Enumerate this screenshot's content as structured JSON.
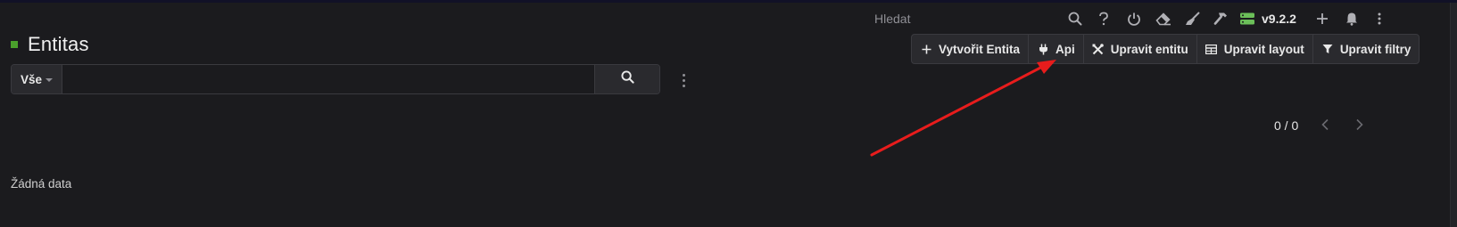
{
  "header": {
    "search_label": "Hledat",
    "version": "v9.2.2",
    "icons": [
      "search-icon",
      "help-icon",
      "power-icon",
      "eraser-icon",
      "broom-icon",
      "hammer-icon",
      "server-icon",
      "plus-icon",
      "bell-icon",
      "more-vertical-icon"
    ]
  },
  "page": {
    "title": "Entitas",
    "title_marker_color": "#4aa02c"
  },
  "actions": {
    "create": "Vytvořit Entita",
    "api": "Api",
    "edit_entity": "Upravit entitu",
    "edit_layout": "Upravit layout",
    "edit_filters": "Upravit filtry"
  },
  "search": {
    "filter_value": "Vše",
    "query": "",
    "placeholder": ""
  },
  "pagination": {
    "count": "0 / 0"
  },
  "list": {
    "empty_text": "Žádná data"
  },
  "colors": {
    "background": "#1b1b1e",
    "accent_green": "#4aa02c",
    "server_icon_green": "#6bbf59",
    "annotation_arrow": "#e81c1c"
  }
}
